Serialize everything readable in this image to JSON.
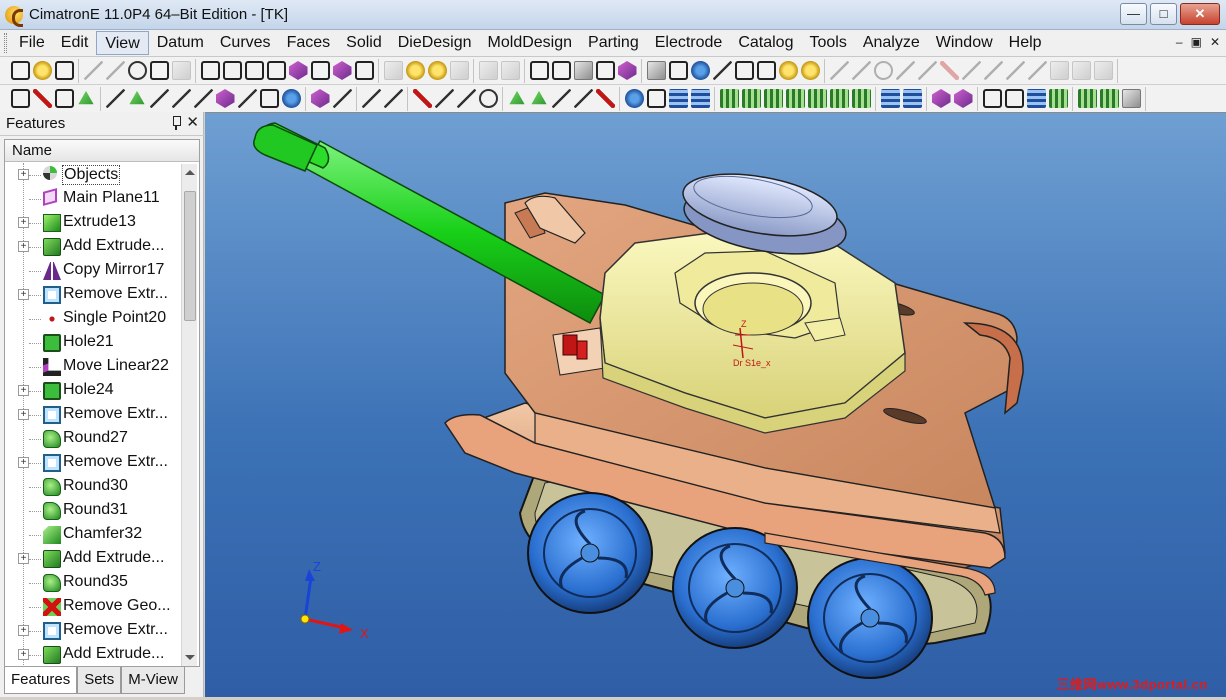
{
  "window": {
    "title": "CimatronE 11.0P4 64–Bit Edition - [TK]",
    "minimize": "—",
    "maximize": "□",
    "close": "✕"
  },
  "menu": {
    "items": [
      "File",
      "Edit",
      "View",
      "Datum",
      "Curves",
      "Faces",
      "Solid",
      "DieDesign",
      "MoldDesign",
      "Parting",
      "Electrode",
      "Catalog",
      "Tools",
      "Analyze",
      "Window",
      "Help"
    ],
    "active": "View",
    "mdi_buttons": [
      "–",
      "▣",
      "✕"
    ]
  },
  "features_panel": {
    "title": "Features",
    "column_header": "Name",
    "items": [
      {
        "label": "Objects",
        "icon": "objects-icon",
        "expandable": true,
        "selected": true
      },
      {
        "label": "Main Plane11",
        "icon": "plane-icon",
        "expandable": false
      },
      {
        "label": "Extrude13",
        "icon": "extrude-icon",
        "expandable": true
      },
      {
        "label": "Add Extrude...",
        "icon": "add-extrude-icon",
        "expandable": true
      },
      {
        "label": "Copy Mirror17",
        "icon": "mirror-icon",
        "expandable": false
      },
      {
        "label": "Remove Extr...",
        "icon": "remove-extrude-icon",
        "expandable": true
      },
      {
        "label": "Single Point20",
        "icon": "point-icon",
        "expandable": false
      },
      {
        "label": "Hole21",
        "icon": "hole-icon",
        "expandable": false
      },
      {
        "label": "Move Linear22",
        "icon": "move-linear-icon",
        "expandable": false
      },
      {
        "label": "Hole24",
        "icon": "hole-icon",
        "expandable": true
      },
      {
        "label": "Remove Extr...",
        "icon": "remove-extrude-icon",
        "expandable": true
      },
      {
        "label": "Round27",
        "icon": "round-icon",
        "expandable": false
      },
      {
        "label": "Remove Extr...",
        "icon": "remove-extrude-icon",
        "expandable": true
      },
      {
        "label": "Round30",
        "icon": "round-icon",
        "expandable": false
      },
      {
        "label": "Round31",
        "icon": "round-icon",
        "expandable": false
      },
      {
        "label": "Chamfer32",
        "icon": "chamfer-icon",
        "expandable": false
      },
      {
        "label": "Add Extrude...",
        "icon": "add-extrude-icon",
        "expandable": true
      },
      {
        "label": "Round35",
        "icon": "round-icon",
        "expandable": false
      },
      {
        "label": "Remove Geo...",
        "icon": "remove-geometry-icon",
        "expandable": false
      },
      {
        "label": "Remove Extr...",
        "icon": "remove-extrude-icon",
        "expandable": true
      },
      {
        "label": "Add Extrude...",
        "icon": "add-extrude-icon",
        "expandable": true
      }
    ],
    "tabs": [
      "Features",
      "Sets",
      "M-View"
    ],
    "active_tab": "Features"
  },
  "viewport": {
    "axis_labels": {
      "z": "Z",
      "x": "X",
      "origin_readout": "Z",
      "origin_coords": "Dr S1e_x"
    },
    "watermark": "三维网www.3dportal.cn",
    "colors": {
      "background_top": "#6f9fd2",
      "background_bottom": "#2f5ea6",
      "hull": "#d99a74",
      "turret": "#f0ec9a",
      "barrel": "#22d422",
      "hatch": "#b8c4e8",
      "wheels": "#2e78d6",
      "tracks": "#bcb890"
    }
  }
}
